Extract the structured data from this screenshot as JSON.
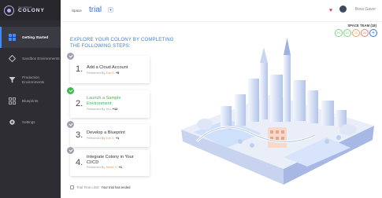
{
  "brand": {
    "sub": "CloudShell",
    "name": "COLONY"
  },
  "sidebar": {
    "items": [
      {
        "label": "Getting Started",
        "icon": "grid-icon"
      },
      {
        "label": "Sandbox Environments",
        "icon": "cube-icon"
      },
      {
        "label": "Production Environments",
        "icon": "funnel-icon"
      },
      {
        "label": "Blueprints",
        "icon": "blueprint-icon"
      },
      {
        "label": "Settings",
        "icon": "gear-icon"
      }
    ]
  },
  "header": {
    "space_label": "Space",
    "space_value": "trial",
    "user_name": "Bess Gaver"
  },
  "team": {
    "title": "SPACE TEAM (18)",
    "avatars": [
      {
        "initials": "BG",
        "color": "#7bd38a"
      },
      {
        "initials": "DS",
        "color": "#7bd38a"
      },
      {
        "initials": "JS",
        "color": "#f0a35e"
      },
      {
        "initials": "AK",
        "color": "#e87a7a"
      }
    ]
  },
  "intro": "EXPLORE YOUR COLONY BY COMPLETING THE FOLLOWING STEPS:",
  "steps": [
    {
      "num": "1.",
      "title": "Add a Cloud Account",
      "by_label": "Performed By",
      "by_name": "Zoe G.",
      "plus": "+5",
      "done": false
    },
    {
      "num": "2.",
      "title": "Launch a Sample Environment",
      "by_label": "Performed By",
      "by_name": "You,",
      "plus": "+12",
      "done": true
    },
    {
      "num": "3.",
      "title": "Develop a Blueprint",
      "by_label": "Performed By",
      "by_name": "Zoe G.",
      "plus": "+1",
      "done": false
    },
    {
      "num": "4.",
      "title": "Integrate Colony in Your CI/CD",
      "by_label": "Performed By",
      "by_name": "Tomer C.",
      "plus": "+1",
      "done": false
    }
  ],
  "trial": {
    "prefix": "Trial Time Limit:",
    "status": "Your trial has ended"
  }
}
